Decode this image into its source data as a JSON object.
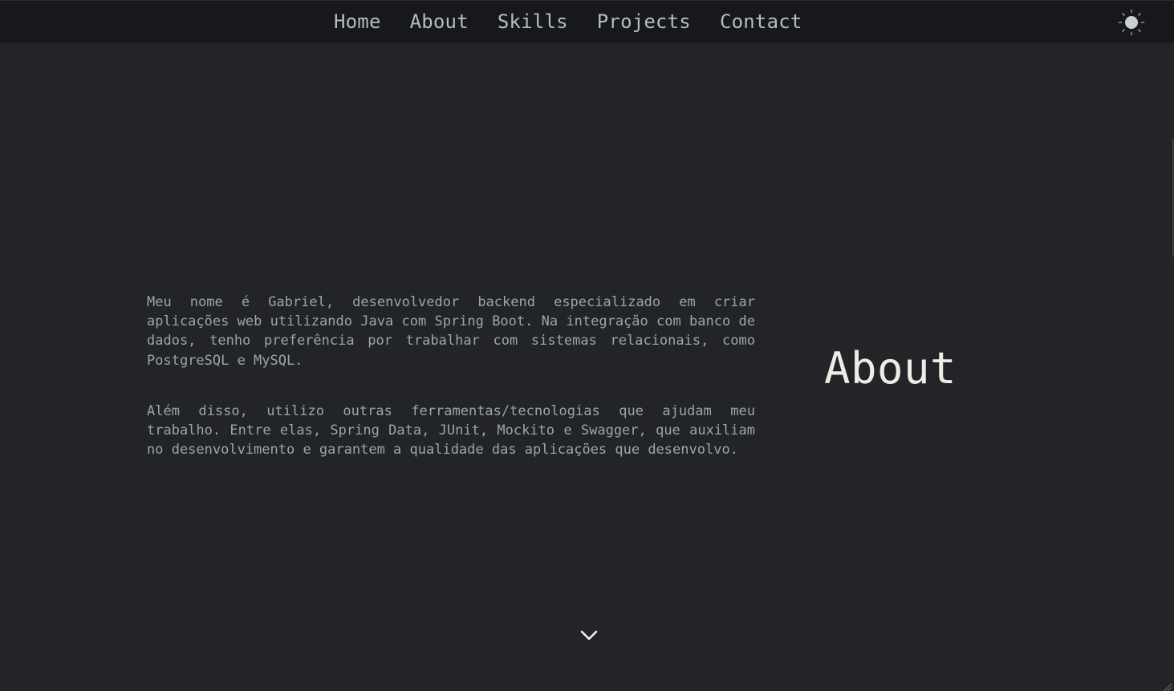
{
  "nav": {
    "items": [
      {
        "label": "Home"
      },
      {
        "label": "About"
      },
      {
        "label": "Skills"
      },
      {
        "label": "Projects"
      },
      {
        "label": "Contact"
      }
    ],
    "theme_toggle_icon": "sun-icon"
  },
  "about": {
    "title": "About",
    "paragraph1": "Meu nome é Gabriel, desenvolvedor backend especializado em criar aplicações web utilizando Java com Spring Boot. Na integração com banco de dados, tenho preferência por trabalhar com sistemas relacionais, como PostgreSQL e MySQL.",
    "paragraph2": "Além disso, utilizo outras ferramentas/tecnologias que ajudam meu trabalho. Entre elas, Spring Data, JUnit, Mockito e Swagger, que auxiliam no desenvolvimento e garantem a qualidade das aplicações que desenvolvo."
  },
  "scroll_hint_icon": "chevron-down-icon",
  "colors": {
    "background": "#222428",
    "navbar": "#17181c",
    "nav_text": "#b5bcc7",
    "body_text": "#9ca4b0",
    "title": "#f0ebe6"
  }
}
